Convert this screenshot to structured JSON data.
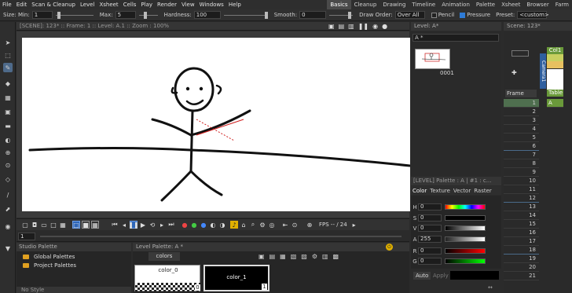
{
  "menu": {
    "items": [
      "File",
      "Edit",
      "Scan & Cleanup",
      "Level",
      "Xsheet",
      "Cells",
      "Play",
      "Render",
      "View",
      "Windows",
      "Help"
    ],
    "rooms": [
      "Basics",
      "Cleanup",
      "Drawing",
      "Timeline",
      "Animation",
      "Palette",
      "Xsheet",
      "Browser",
      "Farm"
    ],
    "active_room": "Basics"
  },
  "tool_options": {
    "size_min_label": "Size: Min:",
    "size_min_value": "1",
    "max_label": "Max:",
    "max_value": "5",
    "hardness_label": "Hardness:",
    "hardness_value": "100",
    "smooth_label": "Smooth:",
    "smooth_value": "0",
    "draw_order_label": "Draw Order:",
    "draw_order_value": "Over All",
    "pencil_label": "Pencil",
    "pressure_label": "Pressure",
    "preset_label": "Preset:",
    "preset_value": "<custom>",
    "pencil_checked": false,
    "pressure_checked": true
  },
  "viewer": {
    "header": "[SCENE]: 123*  ::  Frame: 1  ::  Level: A.1  ::  Zoom : 100%",
    "fps_label": "FPS -- / 24",
    "frame_field": "1"
  },
  "level_strip": {
    "header": "Level: A*",
    "level_select": "A *",
    "thumb_label": "0001"
  },
  "style_editor": {
    "header": "[LEVEL]  Palette : A | #1 : c...",
    "tabs": [
      "Color",
      "Texture",
      "Vector",
      "Raster"
    ],
    "active_tab": "Color",
    "channels": [
      {
        "name": "H",
        "value": "0",
        "color": "#ff0000"
      },
      {
        "name": "S",
        "value": "0",
        "color": "#ffffff"
      },
      {
        "name": "V",
        "value": "0",
        "color": "#ffffff"
      },
      {
        "name": "A",
        "value": "255",
        "color": "#ffffff"
      },
      {
        "name": "R",
        "value": "0",
        "color": "#ff0000"
      },
      {
        "name": "G",
        "value": "0",
        "color": "#00ff00"
      }
    ],
    "auto_label": "Auto",
    "apply_label": "Apply"
  },
  "xsheet": {
    "header": "Scene: 123*",
    "column_name": "Col1",
    "camera_label": "Camera1",
    "table_label": "Table",
    "frame_label": "Frame",
    "cell_label": "A",
    "rows": [
      "1",
      "2",
      "3",
      "4",
      "5",
      "6",
      "7",
      "8",
      "9",
      "10",
      "11",
      "12",
      "13",
      "14",
      "15",
      "16",
      "17",
      "18",
      "19",
      "20",
      "21"
    ]
  },
  "studio_palette": {
    "header": "Studio Palette",
    "items": [
      "Global Palettes",
      "Project Palettes"
    ],
    "no_style": "No Style"
  },
  "level_palette": {
    "header": "Level Palette: A *",
    "tab": "colors",
    "chips": [
      {
        "name": "color_0",
        "index": "0"
      },
      {
        "name": "color_1",
        "index": "1"
      }
    ]
  }
}
